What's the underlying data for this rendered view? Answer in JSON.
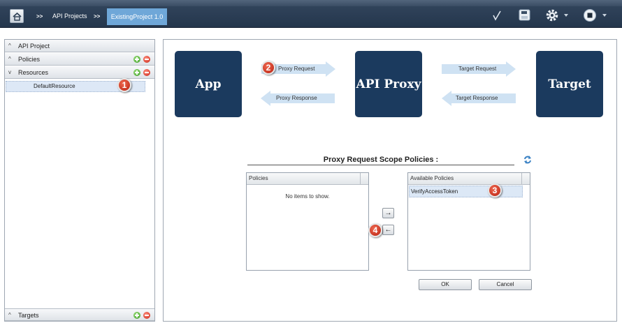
{
  "header": {
    "crumb_sep": ">>",
    "breadcrumb": [
      "API Projects",
      "ExistingProject 1.0"
    ],
    "toolbar_icons": [
      "home-icon",
      "validate-check-icon",
      "save-icon",
      "gear-icon",
      "stop-icon"
    ]
  },
  "sidebar": {
    "sections": [
      {
        "label": "API Project",
        "arrow": "^"
      },
      {
        "label": "Policies",
        "arrow": "^"
      },
      {
        "label": "Resources",
        "arrow": "v"
      },
      {
        "label": "Targets",
        "arrow": "^"
      }
    ],
    "resources": [
      "DefaultResource"
    ]
  },
  "flow": {
    "boxes": [
      "App",
      "API Proxy",
      "Target"
    ],
    "arrows": {
      "proxy_request": "Proxy Request",
      "proxy_response": "Proxy Response",
      "target_request": "Target Request",
      "target_response": "Target Response"
    },
    "box_color": "#1b3a5e",
    "arrow_color": "#cfe2f3"
  },
  "scope": {
    "title": "Proxy Request Scope Policies :",
    "policies_header": "Policies",
    "empty_text": "No items to show.",
    "available_header": "Available Policies",
    "available_items": [
      "VerifyAccessToken"
    ],
    "move_right": "→",
    "move_left": "←",
    "ok_label": "OK",
    "cancel_label": "Cancel"
  },
  "markers": [
    "1",
    "2",
    "3",
    "4"
  ],
  "colors": {
    "accent": "#6fa7d8",
    "marker": "#c8301c",
    "add": "#3c9a26",
    "remove": "#c72515"
  }
}
